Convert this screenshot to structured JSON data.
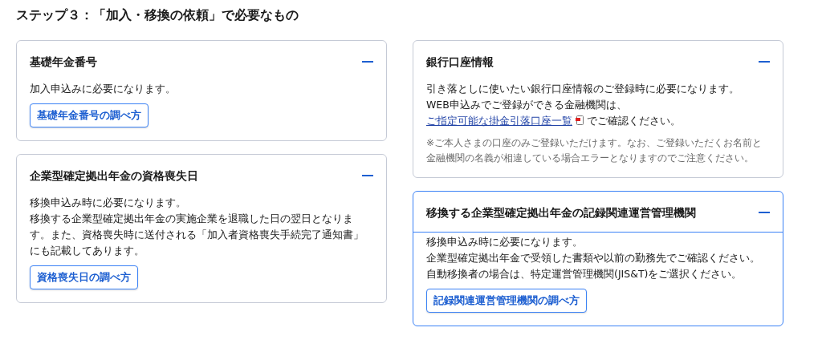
{
  "heading": "ステップ３：「加入・移換の依頼」で必要なもの",
  "columns": [
    {
      "cards": [
        {
          "title": "基礎年金番号",
          "expanded": true,
          "focused": false,
          "paragraphs": [
            {
              "kind": "text",
              "text": "加入申込みに必要になります。"
            }
          ],
          "button": "基礎年金番号の調べ方"
        },
        {
          "title": "企業型確定拠出年金の資格喪失日",
          "expanded": true,
          "focused": false,
          "paragraphs": [
            {
              "kind": "text",
              "text": "移換申込み時に必要になります。"
            },
            {
              "kind": "text",
              "text": "移換する企業型確定拠出年金の実施企業を退職した日の翌日となります。また、資格喪失時に送付される「加入者資格喪失手続完了通知書」にも記載してあります。"
            }
          ],
          "button": "資格喪失日の調べ方"
        }
      ]
    },
    {
      "cards": [
        {
          "title": "銀行口座情報",
          "expanded": true,
          "focused": false,
          "paragraphs": [
            {
              "kind": "text",
              "text": "引き落としに使いたい銀行口座情報のご登録時に必要になります。"
            },
            {
              "kind": "link",
              "before": "WEB申込みでご登録ができる金融機関は、",
              "link": "ご指定可能な掛金引落口座一覧",
              "after": "でご確認ください。"
            },
            {
              "kind": "note",
              "text": "※ご本人さまの口座のみご登録いただけます。なお、ご登録いただくお名前と金融機関の名義が相違している場合エラーとなりますのでご注意ください。"
            }
          ]
        },
        {
          "title": "移換する企業型確定拠出年金の記録関連運営管理機関",
          "expanded": true,
          "focused": true,
          "paragraphs": [
            {
              "kind": "text",
              "text": "移換申込み時に必要になります。"
            },
            {
              "kind": "text",
              "text": "企業型確定拠出年金で受領した書類や以前の勤務先でご確認ください。自動移換者の場合は、特定運営管理機関(JIS&T)をご選択ください。"
            }
          ],
          "button": "記録関連運営管理機関の調べ方"
        }
      ]
    }
  ]
}
